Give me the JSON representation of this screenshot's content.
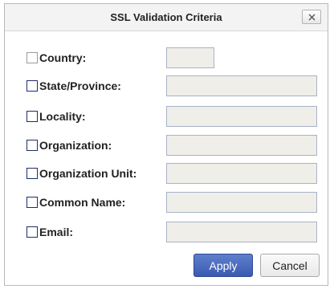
{
  "dialog": {
    "title": "SSL Validation Criteria",
    "close_glyph": "×"
  },
  "fields": [
    {
      "label": "Country:",
      "value": ""
    },
    {
      "label": "State/Province:",
      "value": ""
    },
    {
      "label": "Locality:",
      "value": ""
    },
    {
      "label": "Organization:",
      "value": ""
    },
    {
      "label": "Organization Unit:",
      "value": ""
    },
    {
      "label": "Common Name:",
      "value": ""
    },
    {
      "label": "Email:",
      "value": ""
    }
  ],
  "buttons": {
    "apply": "Apply",
    "cancel": "Cancel"
  },
  "colors": {
    "accent": "#3f5fb3",
    "field_bg": "#efeee8"
  }
}
